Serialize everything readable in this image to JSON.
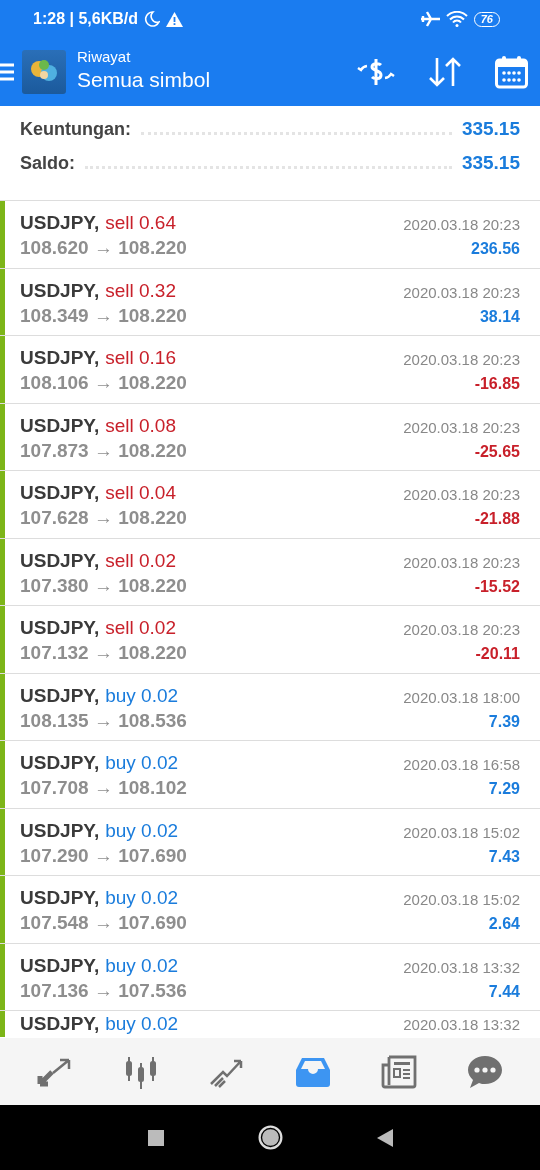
{
  "status_bar": {
    "time": "1:28 | 5,6KB/d",
    "battery": "76"
  },
  "header": {
    "subtitle": "Riwayat",
    "title": "Semua simbol"
  },
  "summary": [
    {
      "label": "Keuntungan:",
      "value": "335.15"
    },
    {
      "label": "Saldo:",
      "value": "335.15"
    }
  ],
  "deals": [
    {
      "symbol": "USDJPY,",
      "kind": "sell",
      "trade": "sell 0.64",
      "prices": "108.620 → 108.220",
      "time": "2020.03.18 20:23",
      "profit": "236.56",
      "loss": false
    },
    {
      "symbol": "USDJPY,",
      "kind": "sell",
      "trade": "sell 0.32",
      "prices": "108.349 → 108.220",
      "time": "2020.03.18 20:23",
      "profit": "38.14",
      "loss": false
    },
    {
      "symbol": "USDJPY,",
      "kind": "sell",
      "trade": "sell 0.16",
      "prices": "108.106 → 108.220",
      "time": "2020.03.18 20:23",
      "profit": "-16.85",
      "loss": true
    },
    {
      "symbol": "USDJPY,",
      "kind": "sell",
      "trade": "sell 0.08",
      "prices": "107.873 → 108.220",
      "time": "2020.03.18 20:23",
      "profit": "-25.65",
      "loss": true
    },
    {
      "symbol": "USDJPY,",
      "kind": "sell",
      "trade": "sell 0.04",
      "prices": "107.628 → 108.220",
      "time": "2020.03.18 20:23",
      "profit": "-21.88",
      "loss": true
    },
    {
      "symbol": "USDJPY,",
      "kind": "sell",
      "trade": "sell 0.02",
      "prices": "107.380 → 108.220",
      "time": "2020.03.18 20:23",
      "profit": "-15.52",
      "loss": true
    },
    {
      "symbol": "USDJPY,",
      "kind": "sell",
      "trade": "sell 0.02",
      "prices": "107.132 → 108.220",
      "time": "2020.03.18 20:23",
      "profit": "-20.11",
      "loss": true
    },
    {
      "symbol": "USDJPY,",
      "kind": "buy",
      "trade": "buy 0.02",
      "prices": "108.135 → 108.536",
      "time": "2020.03.18 18:00",
      "profit": "7.39",
      "loss": false
    },
    {
      "symbol": "USDJPY,",
      "kind": "buy",
      "trade": "buy 0.02",
      "prices": "107.708 → 108.102",
      "time": "2020.03.18 16:58",
      "profit": "7.29",
      "loss": false
    },
    {
      "symbol": "USDJPY,",
      "kind": "buy",
      "trade": "buy 0.02",
      "prices": "107.290 → 107.690",
      "time": "2020.03.18 15:02",
      "profit": "7.43",
      "loss": false
    },
    {
      "symbol": "USDJPY,",
      "kind": "buy",
      "trade": "buy 0.02",
      "prices": "107.548 → 107.690",
      "time": "2020.03.18 15:02",
      "profit": "2.64",
      "loss": false
    },
    {
      "symbol": "USDJPY,",
      "kind": "buy",
      "trade": "buy 0.02",
      "prices": "107.136 → 107.536",
      "time": "2020.03.18 13:32",
      "profit": "7.44",
      "loss": false
    },
    {
      "symbol": "USDJPY,",
      "kind": "buy",
      "trade": "buy 0.02",
      "time": "2020.03.18 13:32"
    }
  ],
  "tabs": [
    {
      "selected": false
    },
    {
      "selected": false
    },
    {
      "selected": false
    },
    {
      "selected": true
    },
    {
      "selected": false
    },
    {
      "selected": false
    }
  ]
}
